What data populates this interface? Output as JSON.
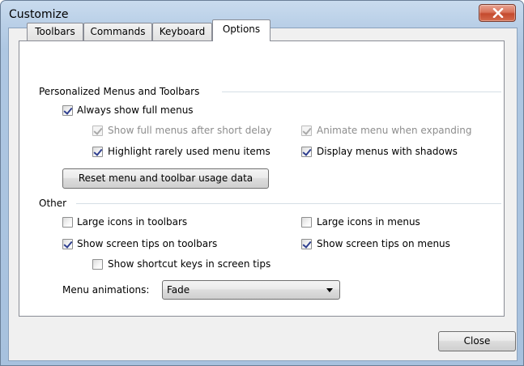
{
  "window": {
    "title": "Customize"
  },
  "tabs": [
    {
      "label": "Toolbars",
      "active": false
    },
    {
      "label": "Commands",
      "active": false
    },
    {
      "label": "Keyboard",
      "active": false
    },
    {
      "label": "Options",
      "active": true
    }
  ],
  "personalized": {
    "heading": "Personalized Menus and Toolbars",
    "always_show_full_menus": {
      "label": "Always show full menus",
      "checked": true,
      "enabled": true
    },
    "show_full_after_delay": {
      "label": "Show full menus after short delay",
      "checked": true,
      "enabled": false
    },
    "animate_when_expanding": {
      "label": "Animate menu when expanding",
      "checked": true,
      "enabled": false
    },
    "highlight_rarely_used": {
      "label": "Highlight rarely used menu items",
      "checked": true,
      "enabled": true
    },
    "display_shadows": {
      "label": "Display menus with shadows",
      "checked": true,
      "enabled": true
    },
    "reset_button": "Reset menu and toolbar usage data"
  },
  "other": {
    "heading": "Other",
    "large_icons_toolbars": {
      "label": "Large icons in toolbars",
      "checked": false
    },
    "large_icons_menus": {
      "label": "Large icons in menus",
      "checked": false
    },
    "screen_tips_toolbars": {
      "label": "Show screen tips on toolbars",
      "checked": true
    },
    "screen_tips_menus": {
      "label": "Show screen tips on menus",
      "checked": true
    },
    "shortcut_keys_tips": {
      "label": "Show shortcut keys in screen tips",
      "checked": false
    },
    "menu_animations_label": "Menu animations:",
    "menu_animations_value": "Fade"
  },
  "footer": {
    "close_button": "Close"
  },
  "icons": {
    "window_close": "close-x-icon",
    "dropdown": "chevron-down-icon"
  },
  "colors": {
    "close_button_red": "#c44a2d",
    "check_mark": "#2f3f8f",
    "window_frame": "#aec7e2"
  }
}
